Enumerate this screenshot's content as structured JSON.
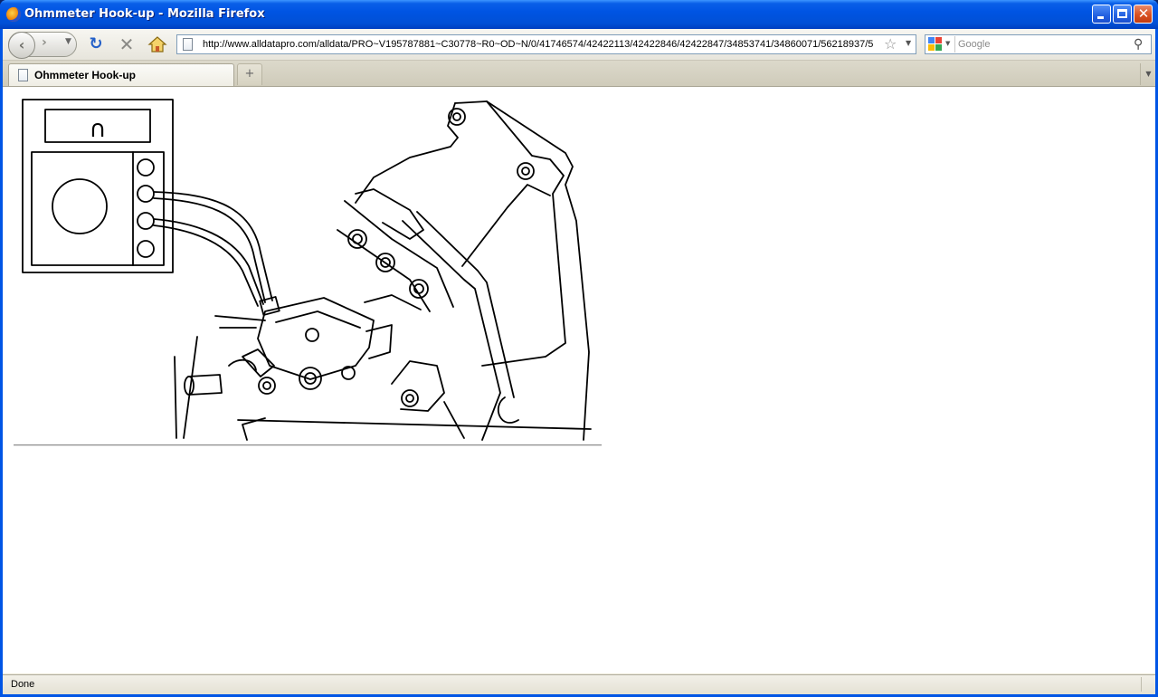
{
  "window": {
    "title": "Ohmmeter Hook-up - Mozilla Firefox",
    "controls": {
      "minimize": "",
      "maximize": "",
      "close": "✕"
    }
  },
  "toolbar": {
    "back": "‹",
    "forward": "›",
    "history_dropdown": "▼",
    "reload": "↻",
    "stop": "✕",
    "url": "http://www.alldatapro.com/alldata/PRO~V195787881~C30778~R0~OD~N/0/41746574/42422113/42422846/42422847/34853741/34860071/56218937/5",
    "bookmark_star": "☆",
    "url_dropdown": "▼",
    "search_engine_dropdown": "▼",
    "search_placeholder": "Google",
    "search_go": "⚲"
  },
  "tabs": [
    {
      "label": "Ohmmeter Hook-up",
      "active": true
    }
  ],
  "tabstrip": {
    "new_tab": "+",
    "list_all": "▼"
  },
  "content": {
    "figure_reading_symbol": "∩"
  },
  "status": {
    "text": "Done"
  },
  "colors": {
    "titlebar": "#0054e3",
    "chrome": "#ece9d8",
    "content_bg": "#ffffff",
    "search_engine": [
      "#4285f4",
      "#ea4335",
      "#fbbc05",
      "#34a853"
    ]
  },
  "icons": [
    "firefox-icon",
    "back-icon",
    "forward-icon",
    "reload-icon",
    "stop-icon",
    "home-icon",
    "page-icon",
    "star-icon",
    "google-icon",
    "magnifier-icon"
  ]
}
